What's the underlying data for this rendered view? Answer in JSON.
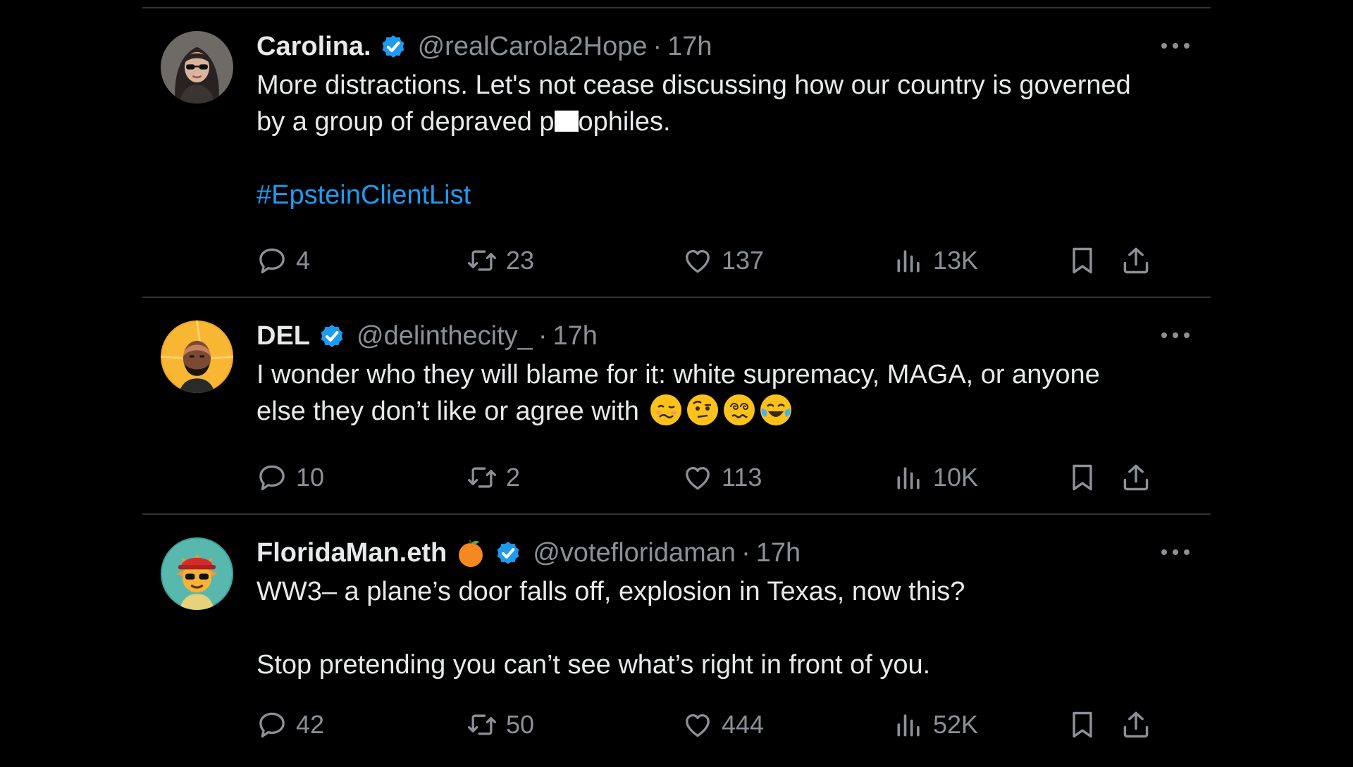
{
  "tweets": [
    {
      "name": "Carolina.",
      "handle": "@realCarola2Hope",
      "separator": "·",
      "time": "17h",
      "verified": true,
      "avatar_icon": "avatar-woman-sunglasses",
      "text_line1": "More distractions. Let's not cease discussing how our country is governed",
      "text_line2_before": "by a group of depraved p",
      "text_line2_after": "ophiles.",
      "hashtag": "#EpsteinClientList",
      "replies": "4",
      "retweets": "23",
      "likes": "137",
      "views": "13K"
    },
    {
      "name": "DEL",
      "handle": "@delinthecity_",
      "separator": "·",
      "time": "17h",
      "verified": true,
      "avatar_icon": "avatar-man-orange-background",
      "text_line1": "I wonder who they will blame for it: white supremacy, MAGA, or anyone",
      "text_line2": "else they don’t like or agree with",
      "emojis": [
        "woozy-face-emoji",
        "raised-eyebrow-face-emoji",
        "dizzy-face-emoji",
        "tears-of-joy-emoji"
      ],
      "replies": "10",
      "retweets": "2",
      "likes": "113",
      "views": "10K"
    },
    {
      "name": "FloridaMan.eth",
      "name_emoji": "orange-emoji",
      "handle": "@votefloridaman",
      "separator": "·",
      "time": "17h",
      "verified": true,
      "avatar_icon": "avatar-cartoon-sun-red-cap",
      "text_line1": "WW3– a plane’s door falls off, explosion in Texas, now this?",
      "text_line2": "Stop pretending you can’t see what’s right in front of you.",
      "replies": "42",
      "retweets": "50",
      "likes": "444",
      "views": "52K"
    }
  ],
  "colors": {
    "background": "#000000",
    "text": "#e7e9ea",
    "muted": "#8b9196",
    "link": "#1d9bf0",
    "verified": "#1d9bf0",
    "divider": "#2f3336"
  }
}
